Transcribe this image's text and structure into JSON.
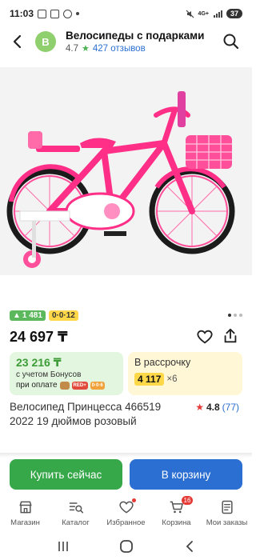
{
  "status_bar": {
    "time": "11:03",
    "signal": "4G+",
    "battery": "37"
  },
  "header": {
    "seller_initial": "В",
    "seller_name": "Велосипеды с подарками",
    "rating": "4.7",
    "reviews": "427 отзывов"
  },
  "badges": {
    "points": "1 481",
    "installment_tag": "0·0·12"
  },
  "price": "24 697 ₸",
  "bonus_card": {
    "price": "23 216 ₸",
    "note": "с учетом Бонусов",
    "pay_label": "при оплате",
    "chip_b": "RED+",
    "chip_c": "0·0·6"
  },
  "install_card": {
    "title": "В рассрочку",
    "amount": "4 117",
    "multiplier": "×6"
  },
  "product": {
    "title": "Велосипед Принцесса 466519 2022 19 дюймов розовый",
    "rating": "4.8",
    "reviews": "(77)"
  },
  "buttons": {
    "buy": "Купить сейчас",
    "cart": "В корзину"
  },
  "nav": {
    "items": [
      {
        "label": "Магазин",
        "icon": "shop-icon"
      },
      {
        "label": "Каталог",
        "icon": "catalog-icon"
      },
      {
        "label": "Избранное",
        "icon": "heart-icon"
      },
      {
        "label": "Корзина",
        "icon": "cart-icon",
        "count": "16"
      },
      {
        "label": "Мои заказы",
        "icon": "orders-icon"
      }
    ]
  },
  "colors": {
    "green": "#36a84a",
    "blue": "#2a6fd1",
    "yellow": "#ffd84a",
    "red": "#e53935"
  }
}
